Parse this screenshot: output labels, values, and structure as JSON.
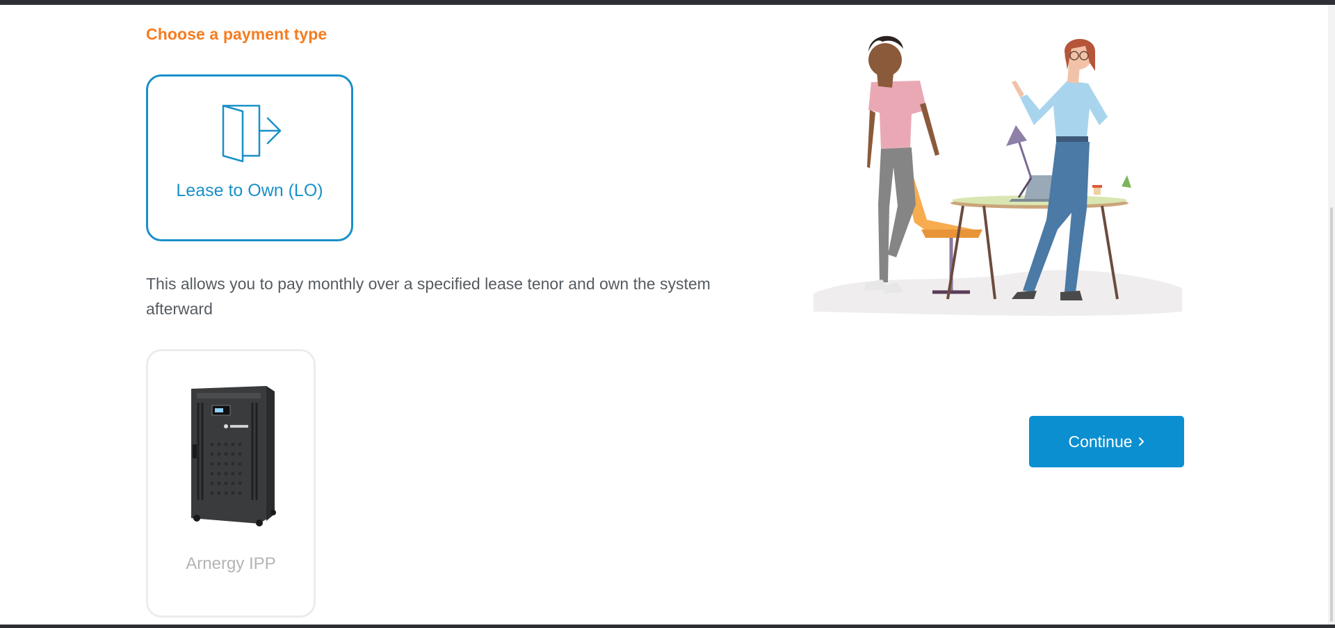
{
  "page": {
    "section_title": "Choose a payment type",
    "description": "This allows you to pay monthly over a specified lease tenor and own the system afterward"
  },
  "payment_options": [
    {
      "label": "Lease to Own (LO)",
      "icon": "door-exit-icon",
      "selected": true
    }
  ],
  "products": [
    {
      "name": "Arnergy IPP",
      "image": "battery-cabinet-image"
    }
  ],
  "actions": {
    "continue_label": "Continue",
    "continue_icon": "chevron-right-icon"
  },
  "colors": {
    "accent_orange": "#f57c1f",
    "primary_blue": "#0b8fd1",
    "card_border_selected": "#1990c8",
    "card_border_unselected": "#ececec"
  }
}
